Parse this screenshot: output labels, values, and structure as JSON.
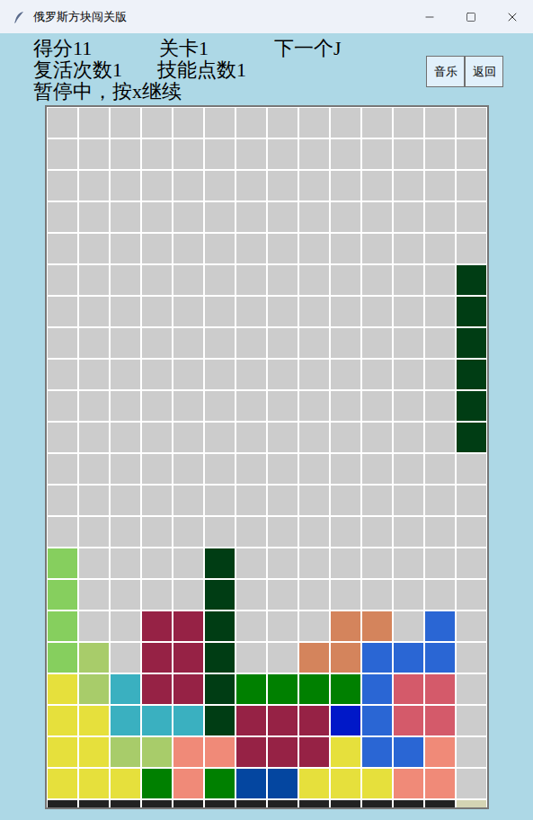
{
  "window": {
    "title": "俄罗斯方块闯关版"
  },
  "status": {
    "score_label": "得分11",
    "level_label": "关卡1",
    "next_label": "下一个J",
    "revives_label": "复活次数1",
    "skill_label": "技能点数1",
    "pause_message": "暂停中，按x继续"
  },
  "buttons": [
    {
      "label": "音乐"
    },
    {
      "label": "返回"
    }
  ],
  "board": {
    "rows": [
      [
        "",
        "",
        "",
        "",
        "",
        "",
        "",
        "",
        "",
        "",
        "",
        "",
        "",
        ""
      ],
      [
        "",
        "",
        "",
        "",
        "",
        "",
        "",
        "",
        "",
        "",
        "",
        "",
        "",
        ""
      ],
      [
        "",
        "",
        "",
        "",
        "",
        "",
        "",
        "",
        "",
        "",
        "",
        "",
        "",
        ""
      ],
      [
        "",
        "",
        "",
        "",
        "",
        "",
        "",
        "",
        "",
        "",
        "",
        "",
        "",
        ""
      ],
      [
        "",
        "",
        "",
        "",
        "",
        "",
        "",
        "",
        "",
        "",
        "",
        "",
        "",
        ""
      ],
      [
        "",
        "",
        "",
        "",
        "",
        "",
        "",
        "",
        "",
        "",
        "",
        "",
        "",
        "#003d14"
      ],
      [
        "",
        "",
        "",
        "",
        "",
        "",
        "",
        "",
        "",
        "",
        "",
        "",
        "",
        "#003d14"
      ],
      [
        "",
        "",
        "",
        "",
        "",
        "",
        "",
        "",
        "",
        "",
        "",
        "",
        "",
        "#003d14"
      ],
      [
        "",
        "",
        "",
        "",
        "",
        "",
        "",
        "",
        "",
        "",
        "",
        "",
        "",
        "#003d14"
      ],
      [
        "",
        "",
        "",
        "",
        "",
        "",
        "",
        "",
        "",
        "",
        "",
        "",
        "",
        "#003d14"
      ],
      [
        "",
        "",
        "",
        "",
        "",
        "",
        "",
        "",
        "",
        "",
        "",
        "",
        "",
        "#003d14"
      ],
      [
        "",
        "",
        "",
        "",
        "",
        "",
        "",
        "",
        "",
        "",
        "",
        "",
        "",
        ""
      ],
      [
        "",
        "",
        "",
        "",
        "",
        "",
        "",
        "",
        "",
        "",
        "",
        "",
        "",
        ""
      ],
      [
        "",
        "",
        "",
        "",
        "",
        "",
        "",
        "",
        "",
        "",
        "",
        "",
        "",
        ""
      ],
      [
        "#86cf5e",
        "",
        "",
        "",
        "",
        "#003d14",
        "",
        "",
        "",
        "",
        "",
        "",
        "",
        ""
      ],
      [
        "#86cf5e",
        "",
        "",
        "",
        "",
        "#003d14",
        "",
        "",
        "",
        "",
        "",
        "",
        "",
        ""
      ],
      [
        "#86cf5e",
        "",
        "",
        "#962245",
        "#962245",
        "#003d14",
        "",
        "",
        "",
        "#d4845c",
        "#d4845c",
        "",
        "#2a66d4",
        ""
      ],
      [
        "#86cf5e",
        "#a8cc6a",
        "",
        "#962245",
        "#962245",
        "#003d14",
        "",
        "",
        "#d4845c",
        "#d4845c",
        "#2a66d4",
        "#2a66d4",
        "#2a66d4",
        ""
      ],
      [
        "#e6e03c",
        "#a8cc6a",
        "#3ab0c0",
        "#962245",
        "#962245",
        "#003d14",
        "#008000",
        "#008000",
        "#008000",
        "#008000",
        "#2a66d4",
        "#d45a6a",
        "#d45a6a",
        ""
      ],
      [
        "#e6e03c",
        "#e6e03c",
        "#3ab0c0",
        "#3ab0c0",
        "#3ab0c0",
        "#003d14",
        "#962245",
        "#962245",
        "#962245",
        "#0018c8",
        "#2a66d4",
        "#d45a6a",
        "#d45a6a",
        ""
      ],
      [
        "#e6e03c",
        "#e6e03c",
        "#a8cc6a",
        "#a8cc6a",
        "#f08a78",
        "#f08a78",
        "#962245",
        "#962245",
        "#962245",
        "#e6e03c",
        "#2a66d4",
        "#2a66d4",
        "#f08a78",
        ""
      ],
      [
        "#e6e03c",
        "#e6e03c",
        "#e6e03c",
        "#008000",
        "#f08a78",
        "#008000",
        "#0446a0",
        "#0446a0",
        "#e6e03c",
        "#e6e03c",
        "#e6e03c",
        "#f08a78",
        "#f08a78",
        ""
      ]
    ],
    "floor": [
      "#222222",
      "#222222",
      "#222222",
      "#222222",
      "#222222",
      "#222222",
      "#222222",
      "#222222",
      "#222222",
      "#222222",
      "#222222",
      "#222222",
      "#222222",
      "#d4d4b4"
    ]
  }
}
